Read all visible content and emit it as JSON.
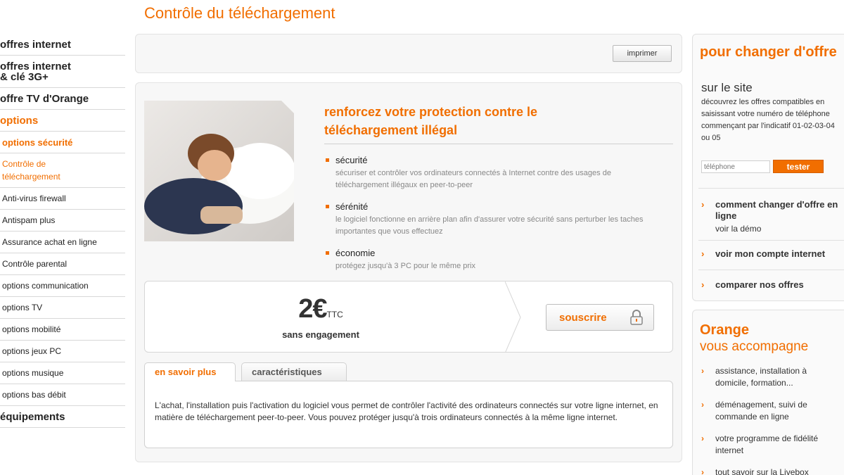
{
  "page": {
    "title": "Contrôle du téléchargement"
  },
  "sidebar": {
    "items": [
      {
        "label": "offres internet"
      },
      {
        "label": "offres internet\n& clé 3G+"
      },
      {
        "label": "offre TV d'Orange"
      },
      {
        "label": "options"
      },
      {
        "label": "options sécurité"
      },
      {
        "label": "Contrôle de\ntéléchargement"
      },
      {
        "label": "Anti-virus firewall"
      },
      {
        "label": "Antispam plus"
      },
      {
        "label": "Assurance achat en ligne"
      },
      {
        "label": "Contrôle parental"
      },
      {
        "label": "options communication"
      },
      {
        "label": "options TV"
      },
      {
        "label": "options mobilité"
      },
      {
        "label": "options jeux PC"
      },
      {
        "label": "options musique"
      },
      {
        "label": "options bas débit"
      },
      {
        "label": "équipements"
      }
    ]
  },
  "toolbar": {
    "print_label": "imprimer"
  },
  "promo": {
    "title": "renforcez votre protection contre le téléchargement illégal",
    "features": [
      {
        "title": "sécurité",
        "desc": "sécuriser et contrôler vos ordinateurs connectés à Internet contre des usages de téléchargement illégaux en peer-to-peer"
      },
      {
        "title": "sérénité",
        "desc": "le logiciel fonctionne en arrière plan afin d'assurer votre sécurité sans perturber les taches importantes que vous effectuez"
      },
      {
        "title": "économie",
        "desc": "protégez jusqu'à 3 PC pour le même prix"
      }
    ]
  },
  "offer": {
    "price": "2€",
    "price_suffix": "TTC",
    "commitment": "sans engagement",
    "subscribe_label": "souscrire"
  },
  "tabs": {
    "items": [
      {
        "label": "en savoir plus"
      },
      {
        "label": "caractéristiques"
      }
    ],
    "content": "L'achat, l'installation puis l'activation du logiciel vous permet de contrôler l'activité des ordinateurs connectés sur votre ligne internet, en matière de téléchargement peer-to-peer. Vous pouvez protéger jusqu'à trois ordinateurs connectés à la même ligne internet."
  },
  "change_offer": {
    "title": "pour changer d'offre",
    "subtitle": "sur le site",
    "description": "découvrez les offres compatibles en saisissant votre numéro de téléphone commençant par l'indicatif 01-02-03-04 ou 05",
    "phone_placeholder": "téléphone",
    "test_label": "tester",
    "links": [
      {
        "label": "comment changer d'offre en ligne",
        "sub": "voir la démo"
      },
      {
        "label": "voir mon compte internet"
      },
      {
        "label": "comparer nos offres"
      }
    ]
  },
  "accompany": {
    "title": "Orange",
    "subtitle": "vous accompagne",
    "links": [
      {
        "label": "assistance, installation à domicile, formation..."
      },
      {
        "label": "déménagement, suivi de commande en ligne"
      },
      {
        "label": "votre programme de fidélité internet"
      },
      {
        "label": "tout savoir sur la Livebox"
      }
    ]
  },
  "colors": {
    "accent": "#f16e00"
  }
}
